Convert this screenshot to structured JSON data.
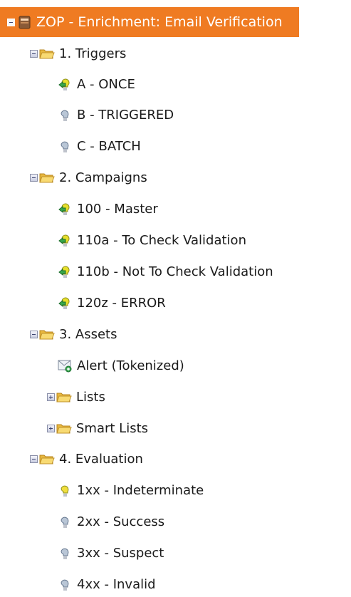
{
  "root": {
    "label": "ZOP - Enrichment: Email Verification"
  },
  "triggers": {
    "label": "1. Triggers",
    "items": [
      "A - ONCE",
      "B - TRIGGERED",
      "C - BATCH"
    ]
  },
  "campaigns": {
    "label": "2. Campaigns",
    "items": [
      "100 - Master",
      "110a - To Check Validation",
      "110b - Not To Check Validation",
      "120z - ERROR"
    ]
  },
  "assets": {
    "label": "3. Assets",
    "alert": "Alert (Tokenized)",
    "lists": "Lists",
    "smart_lists": "Smart Lists"
  },
  "evaluation": {
    "label": "4. Evaluation",
    "items": [
      "1xx - Indeterminate",
      "2xx - Success",
      "3xx - Suspect",
      "4xx - Invalid"
    ]
  },
  "colors": {
    "selected_bg": "#ef7b22",
    "active_bulb": "#e7df2c",
    "inactive_bulb": "#b9c6d6",
    "folder": "#f2cd62"
  }
}
